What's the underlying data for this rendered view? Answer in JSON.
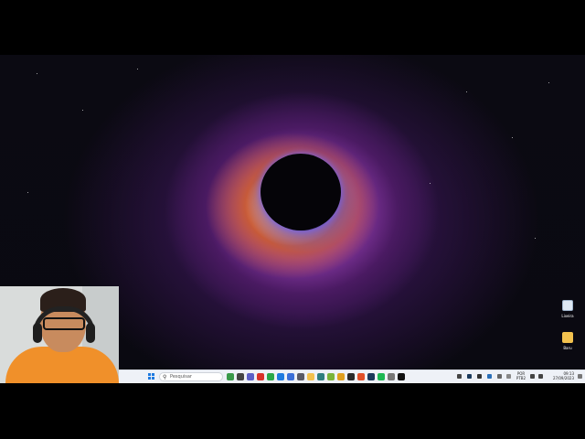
{
  "desktop": {
    "icons": [
      {
        "label": "Lixeira",
        "icon": "recycle-bin-icon",
        "color": "#dfe9f5"
      },
      {
        "label": "Baru",
        "icon": "folder-icon",
        "color": "#f2c14e"
      }
    ]
  },
  "taskbar": {
    "search_placeholder": "Pesquisar",
    "apps": [
      {
        "name": "widgets-icon",
        "color": "#3a9a4a"
      },
      {
        "name": "task-view-icon",
        "color": "#444"
      },
      {
        "name": "chat-icon",
        "color": "#5b5fc7"
      },
      {
        "name": "app-icon-red",
        "color": "#d8322a"
      },
      {
        "name": "app-icon-green",
        "color": "#2aa84a"
      },
      {
        "name": "vscode-icon",
        "color": "#1f7be0"
      },
      {
        "name": "app-icon-blue",
        "color": "#3b6fd8"
      },
      {
        "name": "app-icon-gray",
        "color": "#5a5a66"
      },
      {
        "name": "file-explorer-icon",
        "color": "#f2c14e"
      },
      {
        "name": "app-icon-teal",
        "color": "#2f7f7f"
      },
      {
        "name": "app-icon-lime",
        "color": "#7bb43a"
      },
      {
        "name": "chrome-icon",
        "color": "#e0a020"
      },
      {
        "name": "app-icon-dark",
        "color": "#2b2b2b"
      },
      {
        "name": "app-icon-orange",
        "color": "#e0502a"
      },
      {
        "name": "steam-icon",
        "color": "#1b3a5c"
      },
      {
        "name": "spotify-icon",
        "color": "#1db954"
      },
      {
        "name": "app-icon-outline",
        "color": "#777"
      },
      {
        "name": "app-icon-black",
        "color": "#111"
      }
    ],
    "tray": {
      "lang_line1": "POR",
      "lang_line2": "PTB2",
      "time": "09:13",
      "date": "27/09/2023"
    }
  }
}
